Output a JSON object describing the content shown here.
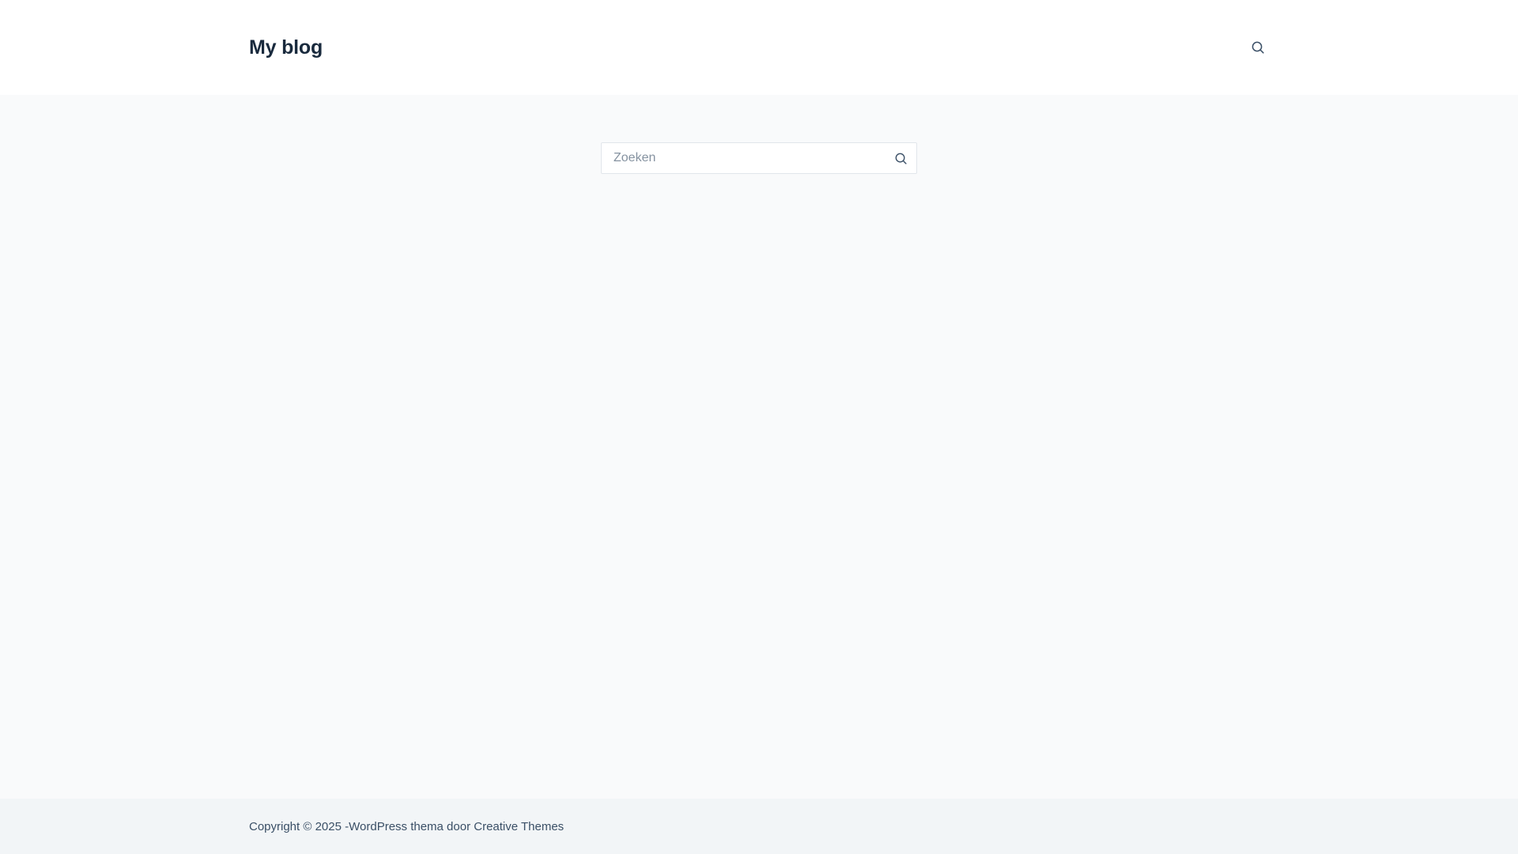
{
  "header": {
    "site_title": "My blog",
    "search_icon": "search-icon"
  },
  "main": {
    "search": {
      "placeholder": "Zoeken",
      "value": "",
      "submit_icon": "search-icon"
    }
  },
  "footer": {
    "copyright_prefix": "Copyright © 2025 - ",
    "wordpress_link": "WordPress thema",
    "by_text": " door ",
    "theme_author_link": "Creative Themes"
  },
  "colors": {
    "page_background": "#f9fafb",
    "header_background": "#ffffff",
    "footer_background": "#f2f5f7",
    "heading_text": "#192a3d",
    "body_text": "#3a4f66",
    "input_border": "#e1e6eb"
  }
}
